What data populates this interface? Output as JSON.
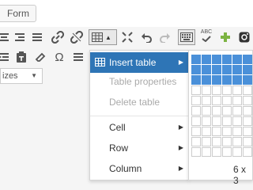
{
  "form_button": {
    "label": "Form"
  },
  "toolbar_row1": {
    "icons": [
      "align-center-icon",
      "align-right-icon",
      "align-justify-icon",
      "link-icon",
      "unlink-icon",
      "table-icon",
      "fullscreen-icon",
      "undo-icon",
      "redo-icon",
      "keyboard-icon",
      "spellcheck-icon",
      "add-icon",
      "instagram-icon"
    ],
    "spellcheck_text": "ABC"
  },
  "toolbar_row2": {
    "icons": [
      "indent-icon",
      "paste-as-text-icon",
      "clear-formatting-icon",
      "special-character-icon",
      "show-blocks-icon"
    ],
    "special_char_text": "Ω"
  },
  "sizes_select": {
    "value": "izes"
  },
  "table_menu": {
    "items": [
      {
        "label": "Insert table",
        "state": "active",
        "has_submenu": true
      },
      {
        "label": "Table properties",
        "state": "disabled",
        "has_submenu": false
      },
      {
        "label": "Delete table",
        "state": "disabled",
        "has_submenu": false
      },
      {
        "label": "Cell",
        "state": "normal",
        "has_submenu": true
      },
      {
        "label": "Row",
        "state": "normal",
        "has_submenu": true
      },
      {
        "label": "Column",
        "state": "normal",
        "has_submenu": true
      }
    ]
  },
  "table_grid": {
    "selection_label": "6 x 3",
    "selected_cols": 6,
    "selected_rows": 3,
    "total_cols": 6,
    "total_rows": 10
  },
  "colors": {
    "accent": "#2e75b6",
    "grid_selected": "#4a90d9",
    "add_icon": "#7cb342"
  }
}
